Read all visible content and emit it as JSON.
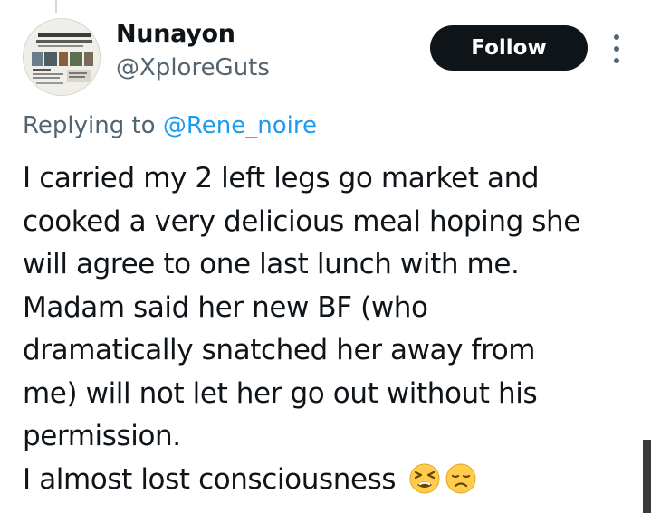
{
  "author": {
    "display_name": "Nunayon",
    "handle": "@XploreGuts",
    "avatar_icon": "newspaper-avatar-icon"
  },
  "follow_button": {
    "label": "Follow"
  },
  "more_menu": {
    "icon": "more-vertical-icon"
  },
  "reply_context": {
    "prefix": "Replying to ",
    "mention": "@Rene_noire"
  },
  "tweet": {
    "lines": [
      "I carried my 2 left legs go market and",
      "cooked a very delicious meal hoping she",
      "will agree to one last lunch with me.",
      "Madam said her new BF (who",
      "dramatically snatched her away from",
      "me) will not let her go out without his",
      "permission.",
      "I almost lost consciousness"
    ],
    "emojis": [
      "tired-face-emoji",
      "disappointed-face-emoji"
    ]
  },
  "colors": {
    "text_primary": "#0f1419",
    "text_secondary": "#536471",
    "link": "#1d9bf0",
    "button_bg": "#0f1419",
    "button_text": "#ffffff",
    "thread_line": "#cfd9de"
  }
}
